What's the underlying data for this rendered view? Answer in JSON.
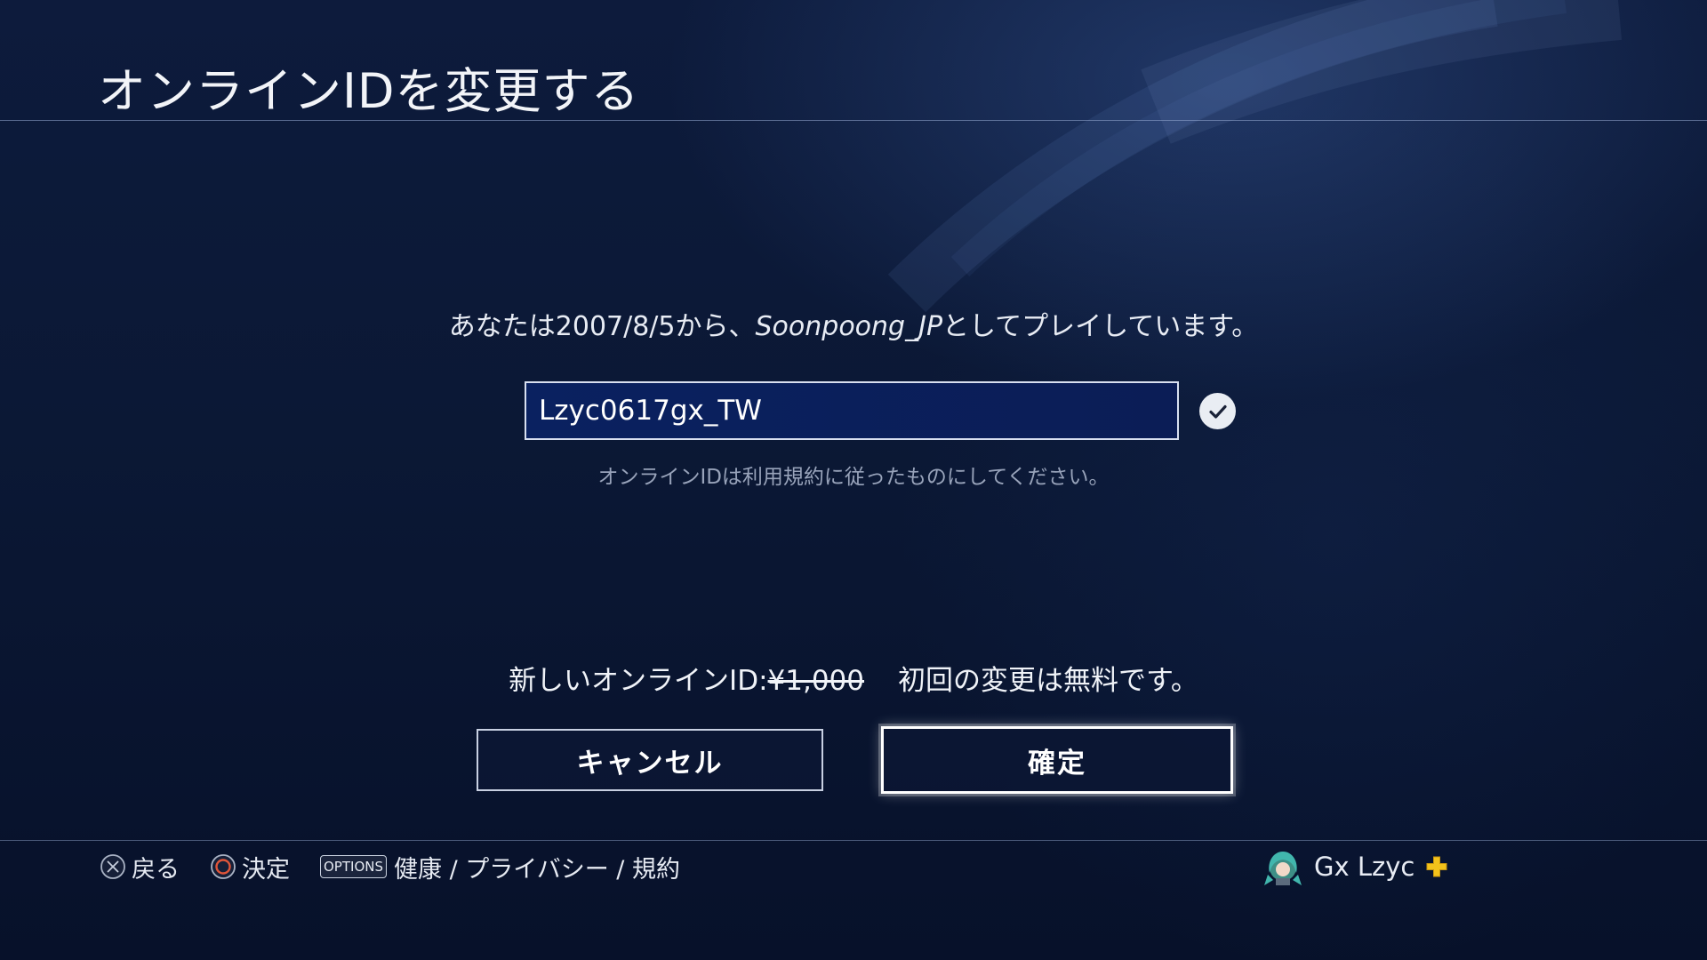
{
  "header": {
    "title": "オンラインIDを変更する"
  },
  "info": {
    "prefix": "あなたは2007/8/5から、",
    "current_id": "Soonpoong_JP",
    "suffix": "としてプレイしています。"
  },
  "id_field": {
    "value": "Lzyc0617gx_TW",
    "valid_icon": "check-circle-icon"
  },
  "hint": "オンラインIDは利用規約に従ったものにしてください。",
  "price": {
    "label": "新しいオンラインID:",
    "old_price": "¥1,000",
    "note": "初回の変更は無料です。"
  },
  "buttons": {
    "cancel": "キャンセル",
    "confirm": "確定"
  },
  "footer": {
    "back_label": "戻る",
    "back_icon": "cross-button-icon",
    "enter_label": "決定",
    "enter_icon": "circle-button-icon",
    "options_badge": "OPTIONS",
    "options_label": "健康 / プライバシー / 規約"
  },
  "user": {
    "name": "Gx Lzyc",
    "plus_icon": "playstation-plus-icon"
  },
  "colors": {
    "background": "#0b1835",
    "circle_button": "#e0553a",
    "plus": "#f3c21b"
  }
}
